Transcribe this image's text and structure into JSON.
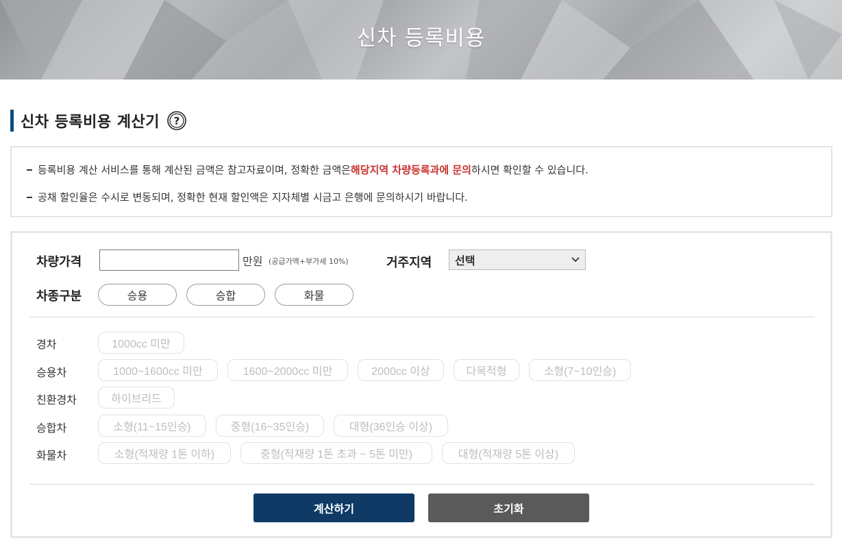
{
  "banner": {
    "title": "신차 등록비용"
  },
  "section": {
    "title": "신차 등록비용 계산기",
    "help_icon": "question-circle-icon"
  },
  "notice": {
    "line1_before": "등록비용 계산 서비스를 통해 계산된 금액은 참고자료이며, 정확한 금액은 ",
    "line1_highlight": "해당지역 차량등록과에 문의",
    "line1_after": "하시면 확인할 수 있습니다.",
    "line2": "공채 할인율은 수시로 변동되며, 정확한 현재 할인액은 지자체별 시금고 은행에 문의하시기 바랍니다.",
    "highlight_color": "#c8322f"
  },
  "form": {
    "price_label": "차량가격",
    "price_value": "",
    "price_unit": "만원",
    "price_note": "(공급가액+부가세 10%)",
    "region_label": "거주지역",
    "region_selected": "선택",
    "type_label": "차종구분",
    "types": [
      "승용",
      "승합",
      "화물"
    ]
  },
  "categories": [
    {
      "label": "경차",
      "options": [
        "1000cc 미만"
      ]
    },
    {
      "label": "승용차",
      "options": [
        "1000~1600cc 미만",
        "1600~2000cc 미만",
        "2000cc 이상",
        "다목적형",
        "소형(7~10인승)"
      ]
    },
    {
      "label": "친환경차",
      "options": [
        "하이브리드"
      ]
    },
    {
      "label": "승합차",
      "options": [
        "소형(11~15인승)",
        "중형(16~35인승)",
        "대형(36인승 이상)"
      ]
    },
    {
      "label": "화물차",
      "options": [
        "소형(적재량 1톤 이하)",
        "중형(적재량 1톤 초과 ~ 5톤 미만)",
        "대형(적재량 5톤 이상)"
      ]
    }
  ],
  "buttons": {
    "calculate": "계산하기",
    "reset": "초기화",
    "calculate_color": "#0f3a66",
    "reset_color": "#5a5a5a"
  }
}
